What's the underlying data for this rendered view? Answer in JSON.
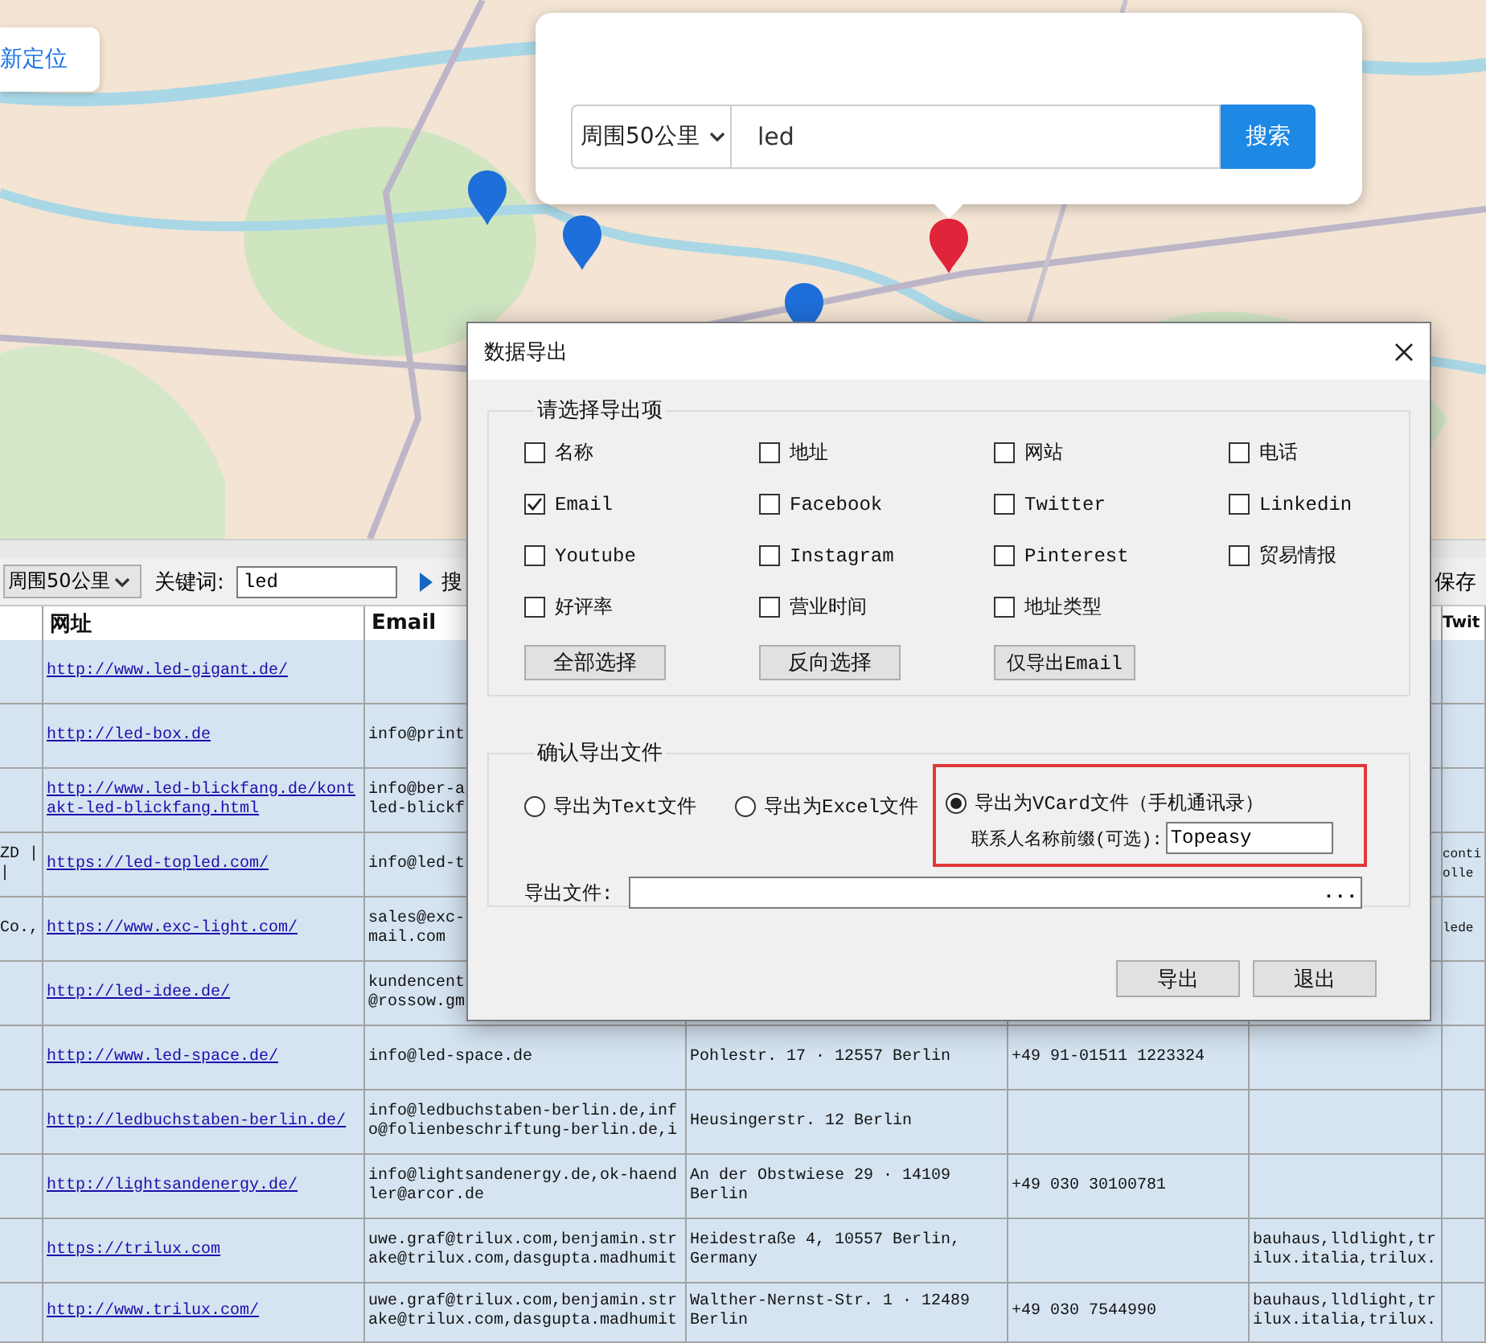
{
  "locate_button": "新定位",
  "map_search": {
    "radius": "周围50公里",
    "keyword": "led",
    "button": "搜索"
  },
  "toolbar": {
    "radius": "周围50公里",
    "keyword_label": "关键词:",
    "keyword": "led",
    "search_button": "搜",
    "save_button": "保存"
  },
  "table": {
    "headers": {
      "url": "网址",
      "email": "Email",
      "column_7": "Twit"
    },
    "rows": [
      {
        "url": "http://www.led-gigant.de/"
      },
      {
        "url": "http://led-box.de",
        "email": "info@print"
      },
      {
        "url": "http://www.led-blickfang.de/kontakt-led-blickfang.html",
        "email": "info@ber-a\nled-blickf"
      },
      {
        "column_1": "ZD |\n|",
        "url": "https://led-topled.com/",
        "email": "info@led-t",
        "column_7": "conti\nolle"
      },
      {
        "column_1": "Co.,",
        "url": "https://www.exc-light.com/",
        "email": "sales@exc-\nmail.com",
        "column_7": "lede"
      },
      {
        "url": "http://led-idee.de/",
        "email": "kundencent\n@rossow.gm"
      },
      {
        "url": "http://www.led-space.de/",
        "email": "info@led-space.de",
        "column_4": "Pohlestr. 17 · 12557 Berlin",
        "column_5": "+49 91-01511 1223324"
      },
      {
        "url": "http://ledbuchstaben-berlin.de/",
        "email": "info@ledbuchstaben-berlin.de,info@folienbeschriftung-berlin.de,i",
        "column_4": "Heusingerstr. 12 Berlin"
      },
      {
        "url": "http://lightsandenergy.de/",
        "email": "info@lightsandenergy.de,ok-haendler@arcor.de",
        "column_4": "An der Obstwiese 29 · 14109 Berlin",
        "column_5": "+49 030 30100781"
      },
      {
        "url": "https://trilux.com",
        "email": "uwe.graf@trilux.com,benjamin.strake@trilux.com,dasgupta.madhumit",
        "column_4": "Heidestraße 4, 10557 Berlin, Germany",
        "column_6": "bauhaus,lldlight,trilux.italia,trilux."
      },
      {
        "url": "http://www.trilux.com/",
        "email": "uwe.graf@trilux.com,benjamin.strake@trilux.com,dasgupta.madhumit",
        "column_4": "Walther-Nernst-Str. 1 · 12489 Berlin",
        "column_5": "+49 030 7544990",
        "column_6": "bauhaus,lldlight,trilux.italia,trilux."
      }
    ]
  },
  "dialog": {
    "title": "数据导出",
    "fields_group": "请选择导出项",
    "export_fields": [
      {
        "label": "名称",
        "checked": false
      },
      {
        "label": "地址",
        "checked": false
      },
      {
        "label": "网站",
        "checked": false
      },
      {
        "label": "电话",
        "checked": false
      },
      {
        "label": "Email",
        "checked": true
      },
      {
        "label": "Facebook",
        "checked": false
      },
      {
        "label": "Twitter",
        "checked": false
      },
      {
        "label": "Linkedin",
        "checked": false
      },
      {
        "label": "Youtube",
        "checked": false
      },
      {
        "label": "Instagram",
        "checked": false
      },
      {
        "label": "Pinterest",
        "checked": false
      },
      {
        "label": "贸易情报",
        "checked": false
      },
      {
        "label": "好评率",
        "checked": false
      },
      {
        "label": "营业时间",
        "checked": false
      },
      {
        "label": "地址类型",
        "checked": false
      }
    ],
    "field_buttons": [
      "全部选择",
      "反向选择",
      "仅导出Email"
    ],
    "file_group": "确认导出文件",
    "formats": [
      {
        "label": "导出为Text文件",
        "selected": false,
        "highlighted": false
      },
      {
        "label": "导出为Excel文件",
        "selected": false,
        "highlighted": false
      },
      {
        "label": "导出为VCard文件（手机通讯录）",
        "selected": true,
        "highlighted": true,
        "prefix_label": "联系人名称前缀(可选):",
        "prefix_value": "Topeasy"
      }
    ],
    "file_label": "导出文件:",
    "browse_button": "...",
    "buttons": [
      "导出",
      "退出"
    ]
  }
}
